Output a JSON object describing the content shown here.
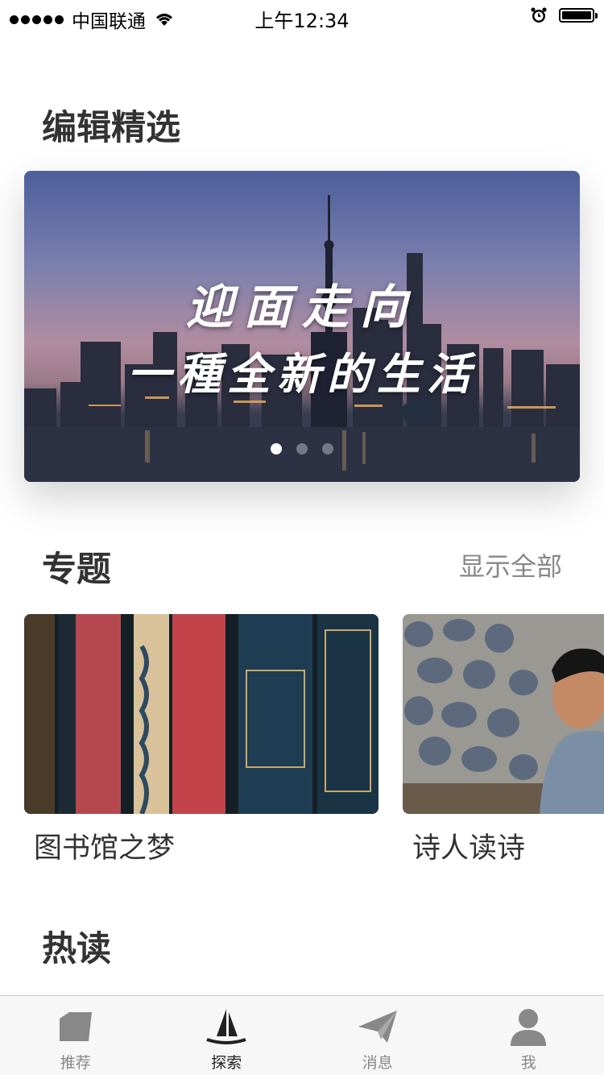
{
  "status_bar": {
    "carrier": "中国联通",
    "time": "上午12:34"
  },
  "editor_pick": {
    "title": "编辑精选",
    "banner": {
      "line1": "迎面走向",
      "line2": "一種全新的生活",
      "page_count": 3,
      "active_page": 1
    }
  },
  "topics": {
    "title": "专题",
    "show_all": "显示全部",
    "items": [
      {
        "label": "图书馆之梦"
      },
      {
        "label": "诗人读诗"
      }
    ]
  },
  "hot": {
    "title": "热读"
  },
  "tab_bar": {
    "active": "explore",
    "items": [
      {
        "id": "recommend",
        "label": "推荐",
        "icon": "card-icon"
      },
      {
        "id": "explore",
        "label": "探索",
        "icon": "sailboat-icon"
      },
      {
        "id": "messages",
        "label": "消息",
        "icon": "paper-plane-icon"
      },
      {
        "id": "me",
        "label": "我",
        "icon": "person-icon"
      }
    ]
  },
  "colors": {
    "tab_active": "#222222",
    "tab_inactive": "#888888",
    "title": "#333333"
  }
}
